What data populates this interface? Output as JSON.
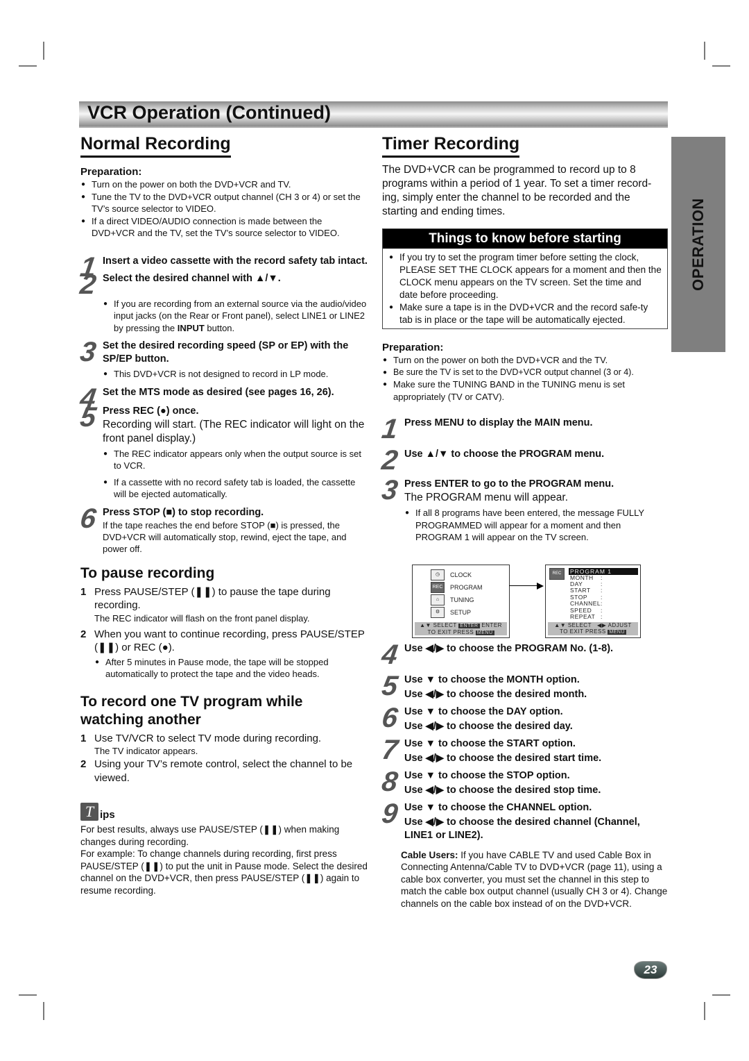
{
  "header": {
    "title": "VCR Operation (Continued)"
  },
  "side_tab": {
    "label": "OPERATION"
  },
  "page_number": "23",
  "normal_recording": {
    "title": "Normal Recording",
    "preparation_label": "Preparation:",
    "preparation": [
      "Turn on the power on both the DVD+VCR and TV.",
      "Tune the TV to the DVD+VCR output channel (CH 3 or 4) or set the TV’s source selector to VIDEO.",
      "If a direct VIDEO/AUDIO connection is made between the DVD+VCR and the TV, set the TV’s source selector to VIDEO."
    ],
    "steps": [
      {
        "num": "1",
        "title": "Insert a video cassette with the record safety tab intact."
      },
      {
        "num": "2",
        "title": "Select the desired channel with ▲/▼.",
        "note_pre": "If you are recording from an external source via the audio/video input jacks (on the Rear or Front panel), select LINE1 or LINE2 by pressing the ",
        "note_bold": "INPUT",
        "note_post": " button."
      },
      {
        "num": "3",
        "title": "Set the desired recording speed (SP or EP) with the SP/EP button.",
        "note": "This DVD+VCR is not designed to record in LP mode."
      },
      {
        "num": "4",
        "title": "Set the MTS mode as desired (see pages 16, 26)."
      },
      {
        "num": "5",
        "title": "Press REC (●) once.",
        "body": "Recording will start. (The REC indicator will light on the front panel display.)",
        "notes": [
          "The REC indicator appears only when the output source is set to VCR.",
          "If a cassette with no record safety tab is loaded, the cassette will be ejected automatically."
        ]
      },
      {
        "num": "6",
        "title": "Press STOP (■) to stop recording.",
        "body": "If the tape reaches the end before STOP (■) is pressed, the DVD+VCR will automatically stop, rewind, eject the tape, and power off."
      }
    ]
  },
  "pause_recording": {
    "title": "To pause recording",
    "items": [
      {
        "n": "1",
        "text": "Press PAUSE/STEP (❚❚) to pause the tape during recording.",
        "note": "The REC indicator will flash on the front panel display."
      },
      {
        "n": "2",
        "text": "When you want to continue recording, press PAUSE/STEP (❚❚) or REC (●).",
        "bullet": "After 5 minutes in Pause mode, the tape will be stopped automatically to protect the tape and the video heads."
      }
    ]
  },
  "record_while_watching": {
    "title": "To record one TV program while watching another",
    "items": [
      {
        "n": "1",
        "text": "Use TV/VCR to select TV mode during recording.",
        "note": "The TV indicator appears."
      },
      {
        "n": "2",
        "text": "Using your TV’s remote control, select the channel to be viewed."
      }
    ]
  },
  "tips": {
    "icon_letter": "T",
    "label": "ips",
    "paragraphs": [
      "For best results, always use PAUSE/STEP (❚❚) when making changes during recording.",
      "For example: To change channels during recording, first press PAUSE/STEP (❚❚) to put the unit in Pause mode. Select the desired channel on the DVD+VCR, then press PAUSE/STEP (❚❚) again to resume recording."
    ]
  },
  "timer_recording": {
    "title": "Timer Recording",
    "intro": "The DVD+VCR can be programmed to record up to 8 programs within a period of 1 year. To set a timer record-ing, simply enter the channel to be recorded and the starting and ending times.",
    "know_box": {
      "title": "Things to know before starting",
      "items": [
        "If you try to set the program timer before setting the clock, PLEASE SET THE CLOCK appears for a moment and then the CLOCK menu appears on the TV screen. Set the time and date before proceeding.",
        "Make sure a tape is in the DVD+VCR and the record safe-ty tab is in place or the tape will be automatically ejected."
      ]
    },
    "preparation_label": "Preparation:",
    "preparation": [
      "Turn on the power on both the DVD+VCR and the TV.",
      "Be sure the TV is set to the DVD+VCR output channel (3 or 4).",
      "Make sure the TUNING BAND in the TUNING menu is set appropriately (TV or CATV)."
    ],
    "steps_a": [
      {
        "num": "1",
        "title": "Press MENU to display the MAIN menu."
      },
      {
        "num": "2",
        "title": "Use ▲/▼ to choose the PROGRAM menu."
      },
      {
        "num": "3",
        "title": "Press ENTER to go to the PROGRAM menu.",
        "body": "The PROGRAM menu will appear.",
        "note": "If all 8 programs have been entered, the message FULLY PROGRAMMED will appear for a moment and then PROGRAM 1 will appear on the TV screen."
      }
    ],
    "osd_main": {
      "items": [
        {
          "icon": "clock-icon",
          "icon_text": "◷",
          "label": "CLOCK"
        },
        {
          "icon": "rec-icon",
          "icon_text": "REC",
          "label": "PROGRAM"
        },
        {
          "icon": "tuning-icon",
          "icon_text": "⌂",
          "label": "TUNING"
        },
        {
          "icon": "setup-icon",
          "icon_text": "⚙",
          "label": "SETUP"
        }
      ],
      "footer_line1_pre": "▲▼ SELECT",
      "footer_key1": "ENTER",
      "footer_line1_post": "ENTER",
      "footer_line2": "TO  EXIT PRESS",
      "footer_key2": "MENU"
    },
    "osd_program": {
      "title": "PROGRAM  1",
      "icon_text": "REC",
      "fields": [
        "MONTH",
        "DAY",
        "START",
        "STOP",
        "CHANNEL",
        "SPEED",
        "REPEAT"
      ],
      "footer_line1_pre": "▲▼ SELECT",
      "footer_line1_post": "◀▶ ADJUST",
      "footer_line2": "TO  EXIT PRESS",
      "footer_key2": "MENU"
    },
    "steps_b": [
      {
        "num": "4",
        "title": "Use  ◀/▶ to choose the PROGRAM No. (1-8)."
      },
      {
        "num": "5",
        "title": "Use ▼ to choose the MONTH option.",
        "title2": "Use ◀/▶ to choose the desired month."
      },
      {
        "num": "6",
        "title": "Use ▼ to choose the DAY option.",
        "title2": "Use ◀/▶ to choose the desired day."
      },
      {
        "num": "7",
        "title": "Use ▼ to choose the START option.",
        "title2": "Use ◀/▶ to choose the desired start time."
      },
      {
        "num": "8",
        "title": "Use ▼ to choose the STOP option.",
        "title2": "Use ◀/▶ to choose the desired stop time."
      },
      {
        "num": "9",
        "title": "Use ▼ to choose the CHANNEL option.",
        "title2": "Use ◀/▶ to choose the desired channel (Channel, LINE1 or LINE2)."
      }
    ],
    "cable_note": {
      "label": "Cable Users:",
      "text": " If you have CABLE TV and used Cable Box in Connecting Antenna/Cable TV to DVD+VCR (page 11), using a cable box converter, you must set the channel in this step to match the cable box output channel (usually CH 3 or 4). Change channels on the cable box instead of on the DVD+VCR."
    }
  }
}
